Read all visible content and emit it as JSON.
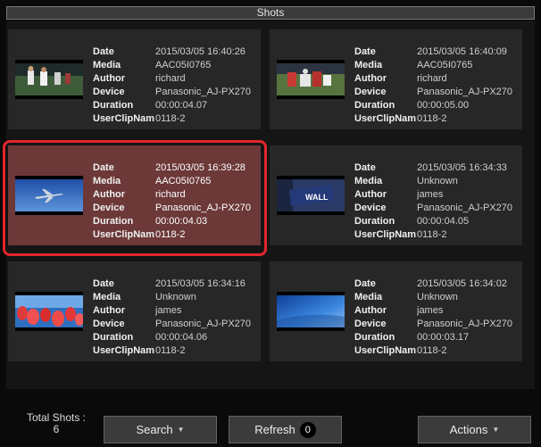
{
  "title": "Shots",
  "shots": [
    {
      "thumbnail": "football-players-icon",
      "date": "2015/03/05 16:40:26",
      "media": "AAC05I0765",
      "author": "richard",
      "device": "Panasonic_AJ-PX270",
      "duration": "00:00:04.07",
      "userclipname": "0118-2"
    },
    {
      "thumbnail": "football-tackle-icon",
      "date": "2015/03/05 16:40:09",
      "media": "AAC05I0765",
      "author": "richard",
      "device": "Panasonic_AJ-PX270",
      "duration": "00:00:05.00",
      "userclipname": "0118-2"
    },
    {
      "thumbnail": "airplane-icon",
      "date": "2015/03/05 16:39:28",
      "media": "AAC05I0765",
      "author": "richard",
      "device": "Panasonic_AJ-PX270",
      "duration": "00:00:04.03",
      "userclipname": "0118-2",
      "selected": true
    },
    {
      "thumbnail": "wall-street-sign-icon",
      "date": "2015/03/05 16:34:33",
      "media": "Unknown",
      "author": "james",
      "device": "Panasonic_AJ-PX270",
      "duration": "00:00:04.05",
      "userclipname": "0118-2"
    },
    {
      "thumbnail": "tulips-icon",
      "date": "2015/03/05 16:34:16",
      "media": "Unknown",
      "author": "james",
      "device": "Panasonic_AJ-PX270",
      "duration": "00:00:04.06",
      "userclipname": "0118-2"
    },
    {
      "thumbnail": "blue-sky-icon",
      "date": "2015/03/05 16:34:02",
      "media": "Unknown",
      "author": "james",
      "device": "Panasonic_AJ-PX270",
      "duration": "00:00:03.17",
      "userclipname": "0118-2"
    }
  ],
  "labels": {
    "date": "Date",
    "media": "Media",
    "author": "Author",
    "device": "Device",
    "duration": "Duration",
    "userclipname": "UserClipNam"
  },
  "footer": {
    "total_label": "Total Shots :",
    "total_count": "6",
    "search_label": "Search",
    "refresh_label": "Refresh",
    "refresh_count": "0",
    "actions_label": "Actions",
    "caret": "▼"
  },
  "colors": {
    "selected_card": "#6c3838",
    "selection_outline": "#e2262c",
    "card": "#272727"
  }
}
